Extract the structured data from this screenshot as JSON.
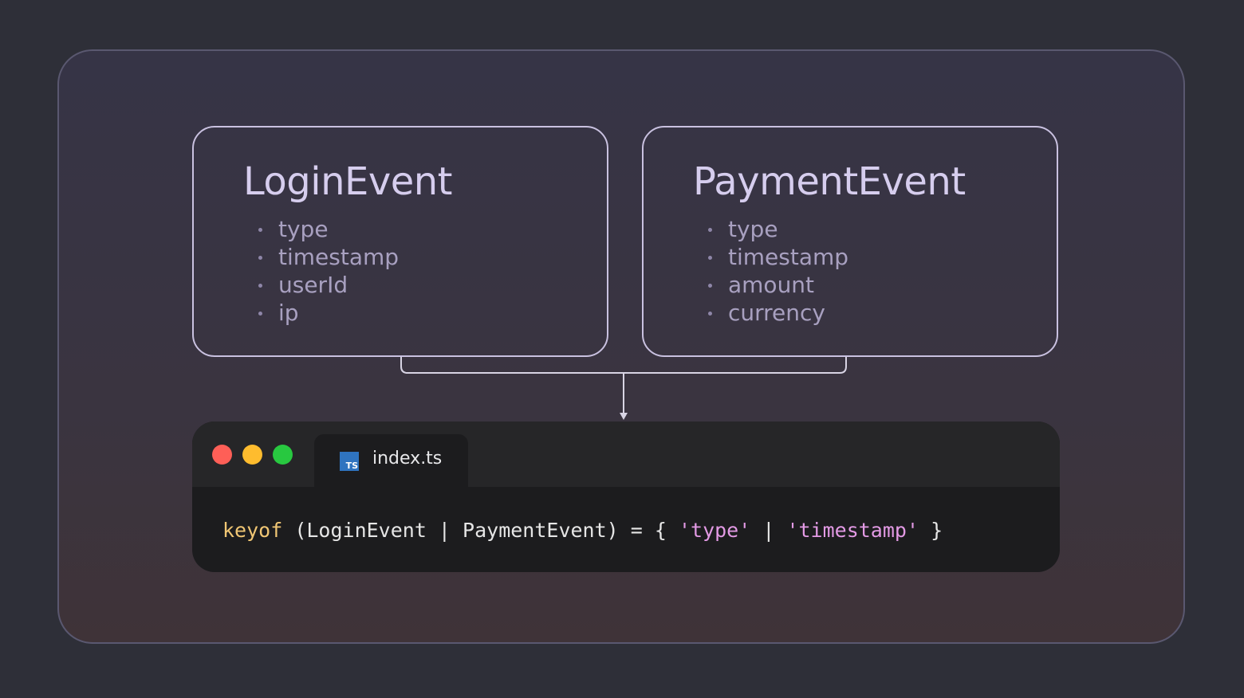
{
  "cards": [
    {
      "title": "LoginEvent",
      "fields": [
        "type",
        "timestamp",
        "userId",
        "ip"
      ]
    },
    {
      "title": "PaymentEvent",
      "fields": [
        "type",
        "timestamp",
        "amount",
        "currency"
      ]
    }
  ],
  "editor": {
    "tab_label": "index.ts",
    "tab_icon": "typescript-file-icon",
    "code": {
      "keyword": "keyof",
      "expr": " (LoginEvent | PaymentEvent) = { ",
      "str1": "'type'",
      "sep": " | ",
      "str2": "'timestamp'",
      "close": " }"
    }
  },
  "colors": {
    "card_border": "#c9c1e0",
    "keyword": "#f0c674",
    "string": "#e39ae5",
    "close_dot": "#fe5f57",
    "minimize_dot": "#febc2e",
    "maximize_dot": "#28c840"
  }
}
